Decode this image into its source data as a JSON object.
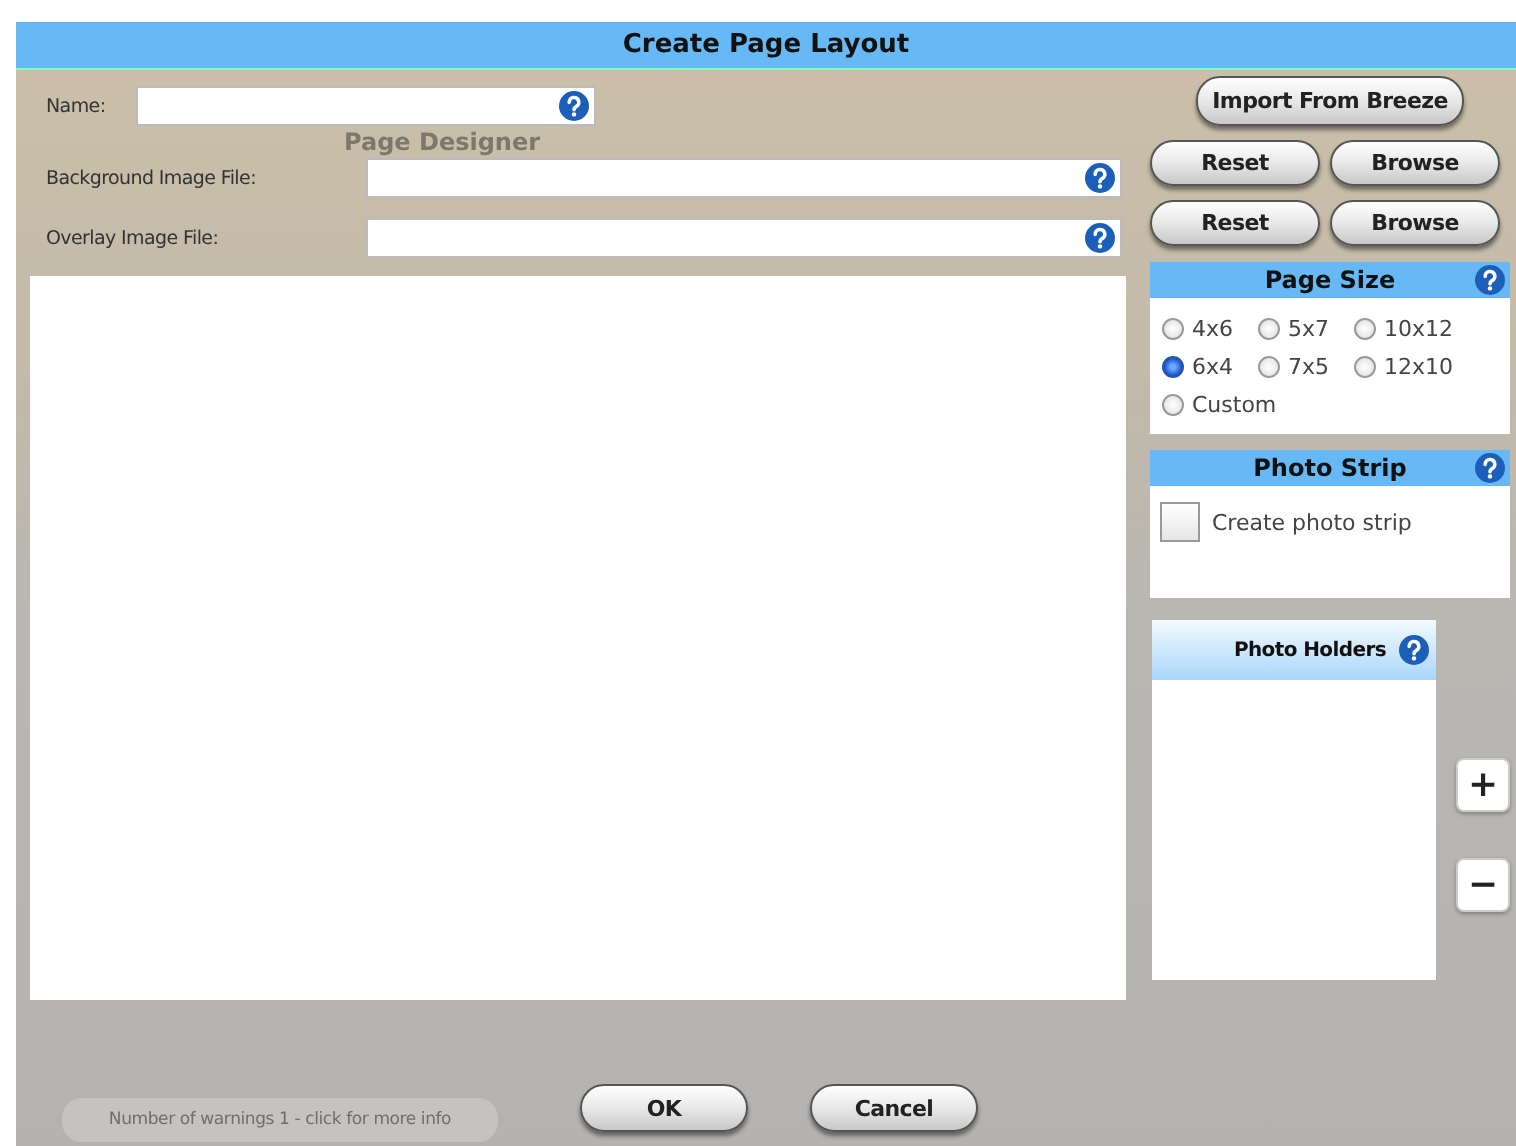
{
  "window": {
    "title": "Create Page Layout"
  },
  "backdrop": {
    "title": "Page Designer",
    "warnings_button": "Number of warnings 1 - click for more info"
  },
  "fields": [
    {
      "kind": "name",
      "label": "Name:"
    },
    {
      "kind": "file",
      "label": "Background Image File:",
      "buttons": [
        "Reset",
        "Browse"
      ]
    },
    {
      "kind": "file",
      "label": "Overlay Image File:",
      "buttons": [
        "Reset",
        "Browse"
      ]
    }
  ],
  "import_button": "Import From Breeze",
  "page_size": {
    "title": "Page Size",
    "options": [
      {
        "label": "4x6",
        "selected": false
      },
      {
        "label": "5x7",
        "selected": false
      },
      {
        "label": "10x12",
        "selected": false
      },
      {
        "label": "6x4",
        "selected": true
      },
      {
        "label": "7x5",
        "selected": false
      },
      {
        "label": "12x10",
        "selected": false
      },
      {
        "label": "Custom",
        "selected": false
      }
    ]
  },
  "photo_strip": {
    "title": "Photo Strip",
    "checkbox": {
      "label": "Create photo strip",
      "checked": false
    }
  },
  "photo_holders": {
    "title": "Photo Holders"
  },
  "holder_buttons": [
    "+",
    "−"
  ],
  "footer_buttons": [
    "OK",
    "Cancel"
  ]
}
